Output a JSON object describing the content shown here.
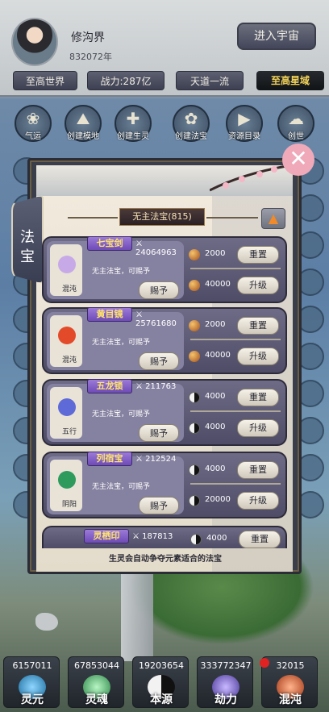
{
  "header": {
    "player_name": "修沟界",
    "player_id": "832072年",
    "enter_button": "进入宇宙",
    "tags": {
      "world": "至高世界",
      "power": "战力:287亿",
      "dao": "天道一流",
      "domain": "至高星域"
    }
  },
  "features": [
    {
      "label": "气运",
      "icon": "luck-icon"
    },
    {
      "label": "创建模地",
      "icon": "mountain-icon"
    },
    {
      "label": "创建生灵",
      "icon": "create-life-icon"
    },
    {
      "label": "创建法宝",
      "icon": "lotus-icon"
    },
    {
      "label": "资源目录",
      "icon": "video-icon"
    },
    {
      "label": "创世",
      "icon": "cloud-icon"
    }
  ],
  "panel": {
    "side_tab": "法宝",
    "title": "无主法宝(815)",
    "footer": "生灵会自动争夺元素适合的法宝",
    "items": [
      {
        "name": "七宝剑",
        "power": "24064963",
        "element": "混沌",
        "description": "无主法宝，可赐予",
        "grant_label": "赐予",
        "reset_cost": "2000",
        "reset_label": "重置",
        "upgrade_cost": "40000",
        "upgrade_label": "升级",
        "currency": "chaos-coin",
        "icon_color": "#c7a9e8"
      },
      {
        "name": "黄目镜",
        "power": "25761680",
        "element": "混沌",
        "description": "无主法宝，可赐予",
        "grant_label": "赐予",
        "reset_cost": "2000",
        "reset_label": "重置",
        "upgrade_cost": "40000",
        "upgrade_label": "升级",
        "currency": "chaos-coin",
        "icon_color": "#e34a2a"
      },
      {
        "name": "五龙锁",
        "power": "211763",
        "element": "五行",
        "description": "无主法宝，可赐予",
        "grant_label": "赐予",
        "reset_cost": "4000",
        "reset_label": "重置",
        "upgrade_cost": "4000",
        "upgrade_label": "升级",
        "currency": "yinyang-coin",
        "icon_color": "#5e6ad8"
      },
      {
        "name": "列宿宝",
        "power": "212524",
        "element": "阴阳",
        "description": "无主法宝，可赐予",
        "grant_label": "赐予",
        "reset_cost": "4000",
        "reset_label": "重置",
        "upgrade_cost": "20000",
        "upgrade_label": "升级",
        "currency": "yinyang-coin",
        "icon_color": "#2e9b5d"
      },
      {
        "name": "灵栖印",
        "power": "187813",
        "element": "",
        "description": "",
        "grant_label": "",
        "reset_cost": "4000",
        "reset_label": "重置",
        "upgrade_cost": "",
        "upgrade_label": "",
        "currency": "yinyang-coin",
        "icon_color": "#c29a3a"
      }
    ]
  },
  "resources": [
    {
      "value": "6157011",
      "label": "灵元",
      "icon": "spirit-orb-icon",
      "color": "#3ea4d8"
    },
    {
      "value": "67853044",
      "label": "灵魂",
      "icon": "soul-icon",
      "color": "#5fbf7a"
    },
    {
      "value": "19203654",
      "label": "本源",
      "icon": "yinyang-icon",
      "color": "#e8c86a"
    },
    {
      "value": "333772347",
      "label": "劫力",
      "icon": "tribulation-icon",
      "color": "#8b7bd8"
    },
    {
      "value": "32015",
      "label": "混沌",
      "icon": "chaos-icon",
      "color": "#e06a3a"
    }
  ]
}
